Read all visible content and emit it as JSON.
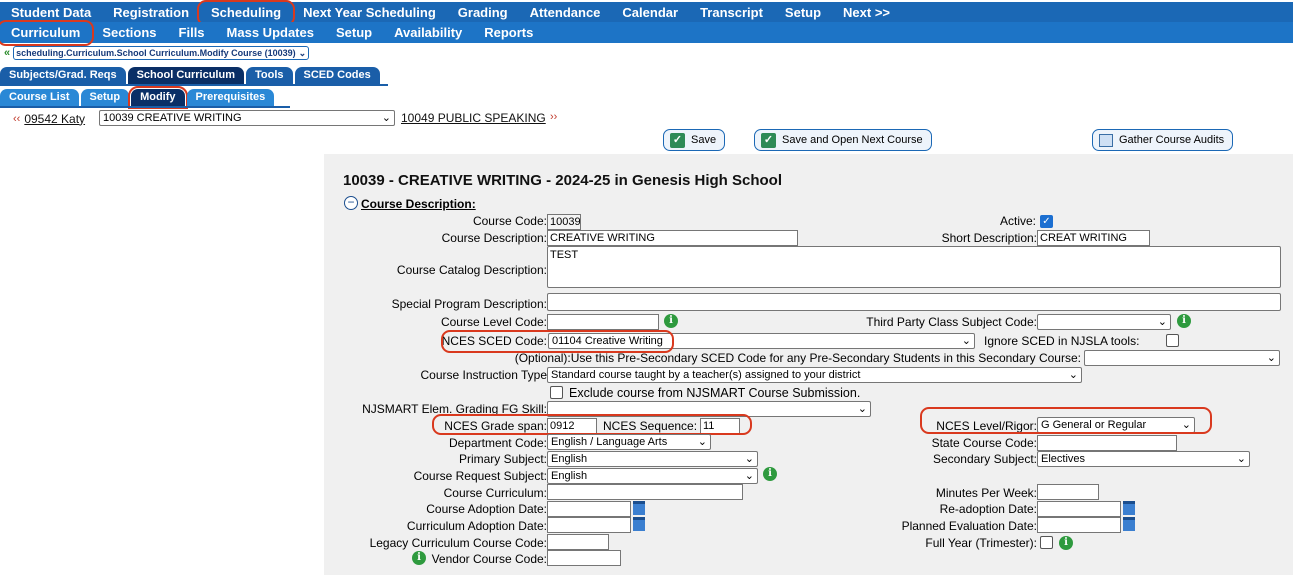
{
  "nav_top": [
    "Student Data",
    "Registration",
    "Scheduling",
    "Next Year Scheduling",
    "Grading",
    "Attendance",
    "Calendar",
    "Transcript",
    "Setup",
    "Next >>"
  ],
  "nav_sub": [
    "Curriculum",
    "Sections",
    "Fills",
    "Mass Updates",
    "Setup",
    "Availability",
    "Reports"
  ],
  "breadcrumb": "scheduling.Curriculum.School Curriculum.Modify Course (10039)",
  "tabs1": [
    "Subjects/Grad. Reqs",
    "School Curriculum",
    "Tools",
    "SCED Codes"
  ],
  "tabs2": [
    "Course List",
    "Setup",
    "Modify",
    "Prerequisites"
  ],
  "course_nav": {
    "prev": "09542 Katy",
    "current": "10039 CREATIVE WRITING",
    "next": "10049 PUBLIC SPEAKING"
  },
  "buttons": {
    "save": "Save",
    "save_next": "Save and Open Next Course",
    "gather": "Gather Course Audits"
  },
  "title": "10039 - CREATIVE WRITING - 2024-25 in Genesis High School",
  "section": "Course Description:",
  "fields": {
    "course_code_label": "Course Code:",
    "course_code": "10039",
    "active_label": "Active:",
    "course_desc_label": "Course Description:",
    "course_desc": "CREATIVE WRITING",
    "short_desc_label": "Short Description:",
    "short_desc": "CREAT WRITING",
    "catalog_label": "Course Catalog Description:",
    "catalog": "TEST",
    "special_label": "Special Program Description:",
    "level_label": "Course Level Code:",
    "third_party_label": "Third Party Class Subject Code:",
    "nces_sced_label": "NCES SCED Code:",
    "nces_sced": "01104 Creative Writing",
    "ignore_sced_label": "Ignore SCED in NJSLA tools:",
    "optional_label": "(Optional):Use this Pre-Secondary SCED Code for any Pre-Secondary Students in this Secondary Course:",
    "instruction_label": "Course Instruction Type",
    "instruction": "Standard course taught by a teacher(s) assigned to your district",
    "exclude_label": "Exclude course from NJSMART Course Submission.",
    "njsmart_label": "NJSMART Elem. Grading FG Skill:",
    "grade_span_label": "NCES Grade span:",
    "grade_span": "0912",
    "sequence_label": "NCES Sequence:",
    "sequence": "11",
    "level_rigor_label": "NCES Level/Rigor:",
    "level_rigor": "G General or Regular",
    "dept_label": "Department Code:",
    "dept": "English / Language Arts",
    "state_code_label": "State Course Code:",
    "primary_label": "Primary Subject:",
    "primary": "English",
    "secondary_label": "Secondary Subject:",
    "secondary": "Electives",
    "request_label": "Course Request Subject:",
    "request": "English",
    "curriculum_label": "Course Curriculum:",
    "minutes_label": "Minutes Per Week:",
    "adoption_label": "Course Adoption Date:",
    "readoption_label": "Re-adoption Date:",
    "curr_adoption_label": "Curriculum Adoption Date:",
    "planned_label": "Planned Evaluation Date:",
    "legacy_label": "Legacy Curriculum Course Code:",
    "full_year_label": "Full Year (Trimester):",
    "vendor_label": "Vendor Course Code:"
  }
}
